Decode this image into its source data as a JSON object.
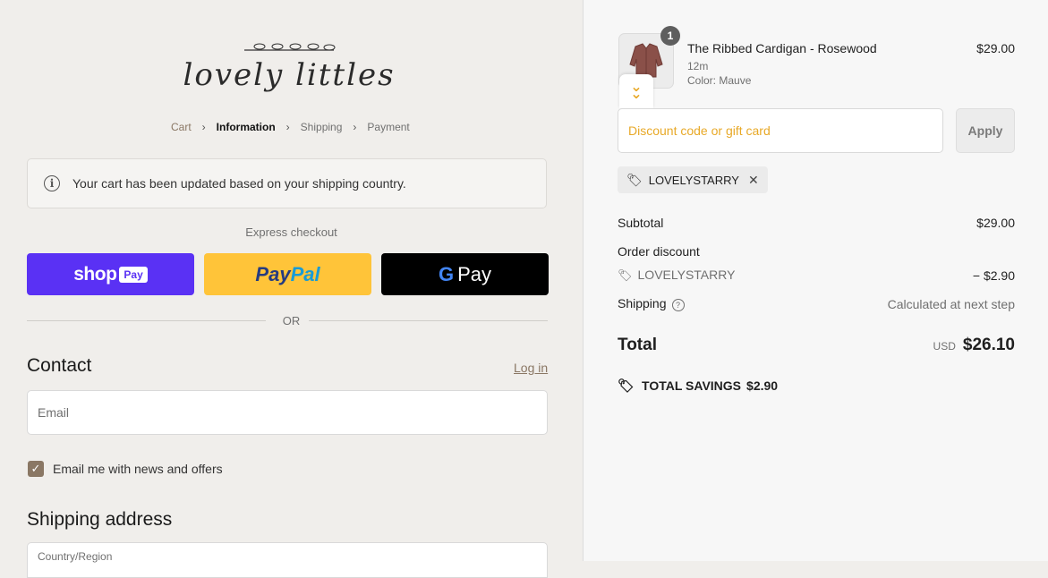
{
  "brand": {
    "logo_text": "lovely littles"
  },
  "breadcrumb": [
    {
      "label": "Cart"
    },
    {
      "label": "Information"
    },
    {
      "label": "Shipping"
    },
    {
      "label": "Payment"
    }
  ],
  "notice": {
    "text": "Your cart has been updated based on your shipping country."
  },
  "express": {
    "label": "Express checkout",
    "shop_word": "shop",
    "shop_pay": "Pay",
    "paypal_a": "Pay",
    "paypal_b": "Pal",
    "gpay_g": "G",
    "gpay_word": "Pay"
  },
  "divider": {
    "or": "OR"
  },
  "contact": {
    "title": "Contact",
    "login": "Log in",
    "email_placeholder": "Email",
    "news_label": "Email me with news and offers"
  },
  "shipping_address": {
    "title": "Shipping address",
    "country_label": "Country/Region"
  },
  "order": {
    "qty": "1",
    "product_name": "The Ribbed Cardigan - Rosewood",
    "variant": "12m",
    "color": "Color: Mauve",
    "price": "$29.00",
    "discount_placeholder": "Discount code or gift card",
    "apply": "Apply",
    "applied_code": "LOVELYSTARRY",
    "subtotal_label": "Subtotal",
    "subtotal_value": "$29.00",
    "order_discount_label": "Order discount",
    "discount_code": "LOVELYSTARRY",
    "discount_value": "− $2.90",
    "shipping_label": "Shipping",
    "shipping_value": "Calculated at next step",
    "total_label": "Total",
    "currency": "USD",
    "total_value": "$26.10",
    "savings_label": "TOTAL SAVINGS",
    "savings_value": "$2.90"
  },
  "colors": {
    "accent_brown": "#8a7764",
    "shop_purple": "#5a31f4",
    "paypal_yellow": "#ffc439",
    "placeholder_orange": "#e8a928"
  }
}
